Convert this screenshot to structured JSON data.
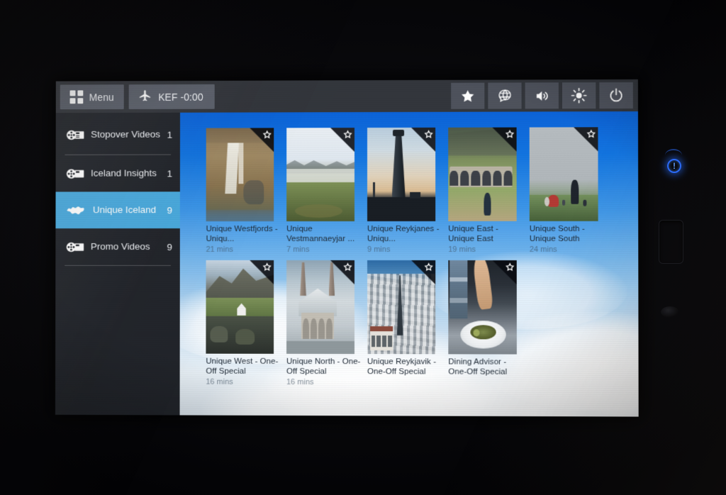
{
  "device": {
    "type": "in-flight-entertainment-screen",
    "indicator_icon": "power-indicator-glow",
    "jack_icon": "headphone-jack"
  },
  "toolbar": {
    "menu_label": "Menu",
    "menu_icon": "grid-icon",
    "flight_label": "KEF -0:00",
    "flight_icon": "airplane-icon",
    "icons": [
      {
        "name": "favorites-icon",
        "glyph": "star"
      },
      {
        "name": "language-icon",
        "glyph": "globe-speech"
      },
      {
        "name": "volume-icon",
        "glyph": "speaker"
      },
      {
        "name": "brightness-icon",
        "glyph": "sun"
      },
      {
        "name": "power-icon",
        "glyph": "power"
      }
    ]
  },
  "sidebar": {
    "items": [
      {
        "label": "Stopover Videos",
        "count": "1",
        "icon": "film-reel-icon",
        "selected": false
      },
      {
        "label": "Iceland Insights",
        "count": "1",
        "icon": "film-reel-icon",
        "selected": false
      },
      {
        "label": "Unique Iceland",
        "count": "9",
        "icon": "iceland-map-icon",
        "selected": true
      },
      {
        "label": "Promo Videos",
        "count": "9",
        "icon": "film-reel-icon",
        "selected": false
      }
    ]
  },
  "content": {
    "tiles": [
      {
        "title": "Unique Westfjords - Uniqu...",
        "duration": "21 mins",
        "bookmark": "star-icon",
        "art": "waterfall"
      },
      {
        "title": "Unique Vestmannaeyjar ...",
        "duration": "7 mins",
        "bookmark": "star-icon",
        "art": "cliffs"
      },
      {
        "title": "Unique Reykjanes - Uniqu...",
        "duration": "9 mins",
        "bookmark": "star-icon",
        "art": "lighthouse"
      },
      {
        "title": "Unique East - Unique East",
        "duration": "19 mins",
        "bookmark": "star-icon",
        "art": "turfhouse"
      },
      {
        "title": "Unique South - Unique South",
        "duration": "24 mins",
        "bookmark": "star-icon",
        "art": "hillpeople"
      },
      {
        "title": "Unique West - One-Off Special",
        "duration": "16 mins",
        "bookmark": "star-icon",
        "art": "mountain"
      },
      {
        "title": "Unique North - One-Off Special",
        "duration": "16 mins",
        "bookmark": "star-icon",
        "art": "church"
      },
      {
        "title": "Unique Reykjavik - One-Off Special",
        "duration": "",
        "bookmark": "star-icon",
        "art": "cityscape"
      },
      {
        "title": "Dining Advisor - One-Off Special",
        "duration": "",
        "bookmark": "star-icon",
        "art": "dining"
      }
    ]
  },
  "colors": {
    "toolbar_bg": "#33363c",
    "sidebar_bg": "#22252b",
    "selection_blue": "#4aaade",
    "sky_blue": "#0c63d8",
    "title_text": "#1c2733"
  }
}
